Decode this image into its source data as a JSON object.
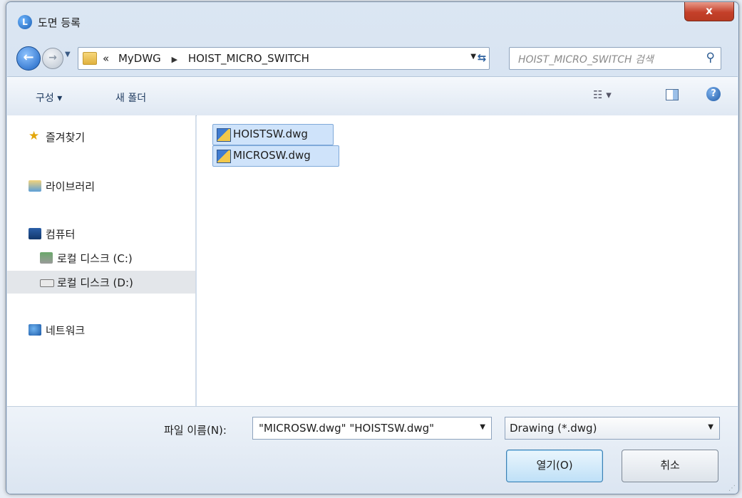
{
  "window": {
    "title": "도면 등록",
    "close_label": "x"
  },
  "navigation": {
    "path_prefix": "«",
    "path": [
      "MyDWG",
      "HOIST_MICRO_SWITCH"
    ],
    "search_placeholder": "HOIST_MICRO_SWITCH 검색"
  },
  "toolbar": {
    "organize_label": "구성 ▾",
    "new_folder_label": "새 폴더"
  },
  "sidebar": {
    "items": [
      {
        "label": "즐겨찾기",
        "icon": "star-icon"
      },
      {
        "label": "라이브러리",
        "icon": "library-icon"
      },
      {
        "label": "컴퓨터",
        "icon": "computer-icon"
      },
      {
        "label": "로컬 디스크 (C:)",
        "icon": "drive-icon"
      },
      {
        "label": "로컬 디스크 (D:)",
        "icon": "drive-icon",
        "selected": true
      },
      {
        "label": "네트워크",
        "icon": "network-icon"
      }
    ]
  },
  "files": [
    {
      "name": "HOISTSW.dwg",
      "selected": true
    },
    {
      "name": "MICROSW.dwg",
      "selected": true
    }
  ],
  "footer": {
    "filename_label": "파일 이름(N):",
    "filename_value": "\"MICROSW.dwg\" \"HOISTSW.dwg\"",
    "filter_value": "Drawing (*.dwg)",
    "open_label": "열기(O)",
    "cancel_label": "취소"
  },
  "colors": {
    "accent": "#1c63c2",
    "selection": "#cfe3fa",
    "close": "#c4402a"
  }
}
